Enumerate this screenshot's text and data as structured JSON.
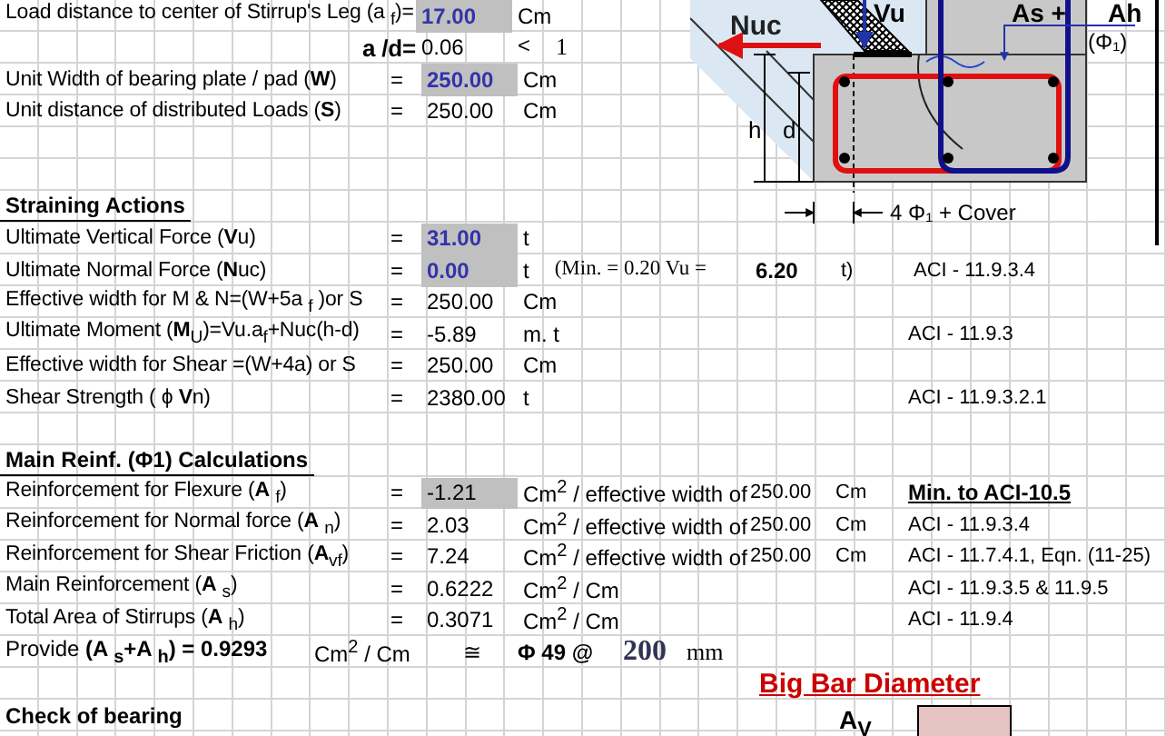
{
  "inputs": [
    {
      "kind": "field",
      "label": "Load distance to center of Stirrup's Leg (a $_{f}$)=",
      "value": "17.00",
      "shaded": true,
      "entered": true,
      "unit": "Cm"
    },
    {
      "kind": "ratio",
      "label": "a /d=",
      "value": "0.06",
      "shaded": false,
      "entered": false,
      "unit": "<",
      "note": "1"
    },
    {
      "kind": "field",
      "label": "Unit Width of bearing plate / pad  (**W**)",
      "eq": "=",
      "value": "250.00",
      "shaded": true,
      "entered": true,
      "unit": "Cm"
    },
    {
      "kind": "field",
      "label": "Unit distance of distributed Loads  (**S**)",
      "eq": "=",
      "value": "250.00",
      "shaded": false,
      "entered": false,
      "unit": "Cm"
    }
  ],
  "straining_actions": {
    "heading": "Straining Actions",
    "rows": [
      {
        "kind": "field",
        "label": "Ultimate Vertical Force (**V**u)",
        "eq": "=",
        "value": "31.00",
        "shaded": true,
        "entered": true,
        "unit": "t"
      },
      {
        "kind": "field",
        "label": "Ultimate Normal Force (**N**uc)",
        "eq": "=",
        "value": "0.00",
        "shaded": true,
        "entered": true,
        "unit": "t",
        "note": "(Min. = 0.20 Vu =",
        "note_value": "6.20",
        "note_unit": "t)",
        "ref": "ACI - 11.9.3.4",
        "ref_emphasized": false
      },
      {
        "kind": "field",
        "label": "Effective width for M & N=(W+5a $_{f}$ )or S",
        "eq": "=",
        "value": "250.00",
        "shaded": false,
        "entered": false,
        "unit": "Cm"
      },
      {
        "kind": "field",
        "label": "Ultimate Moment (**M**$_{U}$)=Vu.a$_{f}$+Nuc(h-d)",
        "eq": "=",
        "value": "-5.89",
        "shaded": false,
        "entered": false,
        "unit": "m. t",
        "ref": "ACI - 11.9.3",
        "ref_emphasized": false
      },
      {
        "kind": "field",
        "label": "Effective width for Shear =(W+4a) or S",
        "eq": "=",
        "value": "250.00",
        "shaded": false,
        "entered": false,
        "unit": "Cm"
      },
      {
        "kind": "field",
        "label": "Shear Strength ( ϕ **V**n)",
        "eq": "=",
        "value": "2380.00",
        "shaded": false,
        "entered": false,
        "unit": "t",
        "ref": "ACI - 11.9.3.2.1",
        "ref_emphasized": false
      }
    ]
  },
  "main_reinforcement": {
    "heading": "Main Reinf. (Φ1)  Calculations",
    "rows": [
      {
        "kind": "field",
        "label": "Reinforcement for Flexure (**A** $_{f}$)",
        "eq": "=",
        "value": "-1.21",
        "shaded": true,
        "entered": false,
        "unit": "Cm$^{2}$ / effective width of",
        "note_value": "250.00",
        "note_unit": "Cm",
        "ref": "Min. to ACI-10.5",
        "ref_emphasized": true
      },
      {
        "kind": "field",
        "label": "Reinforcement for Normal force (**A** $_{n}$)",
        "eq": "=",
        "value": "2.03",
        "shaded": false,
        "entered": false,
        "unit": "Cm$^{2}$ / effective width of",
        "note_value": "250.00",
        "note_unit": "Cm",
        "ref": "ACI - 11.9.3.4",
        "ref_emphasized": false
      },
      {
        "kind": "field",
        "label": "Reinforcement for Shear Friction (**A**$_{vf}$)",
        "eq": "=",
        "value": "7.24",
        "shaded": false,
        "entered": false,
        "unit": "Cm$^{2}$ / effective width of",
        "note_value": "250.00",
        "note_unit": "Cm",
        "ref": "ACI - 11.7.4.1, Eqn. (11-25)",
        "ref_emphasized": false
      },
      {
        "kind": "field",
        "label": "Main Reinforcement (**A** $_{s}$)",
        "eq": "=",
        "value": "0.6222",
        "shaded": false,
        "entered": false,
        "unit": "Cm$^{2}$ / Cm",
        "ref": "ACI - 11.9.3.5 & 11.9.5",
        "ref_emphasized": false
      },
      {
        "kind": "field",
        "label": "Total Area of Stirrups  (**A** $_{h}$)",
        "eq": "=",
        "value": "0.3071",
        "shaded": false,
        "entered": false,
        "unit": "Cm$^{2}$ / Cm",
        "ref": "ACI - 11.9.4",
        "ref_emphasized": false
      }
    ],
    "provide": {
      "label": "Provide **(A $_{s}$+A $_{h}$) =  0.9293**",
      "unit": "Cm$^{2}$ / Cm",
      "approx": "≅",
      "bar": "Φ 49 @",
      "spacing": "200",
      "spacing_unit": "mm"
    }
  },
  "big_bar": {
    "title": "Big Bar Diameter",
    "label": "A$_{V}$"
  },
  "check": {
    "heading": "Check of  bearing"
  },
  "diagram": {
    "normal_force": "Nuc",
    "vertical_force": "Vu",
    "steel_main": "As +",
    "steel_hoop": "Ah",
    "bar": "(Φ₁)",
    "height": "h",
    "depth": "d",
    "spacing": "4 Φ₁ + Cover"
  }
}
